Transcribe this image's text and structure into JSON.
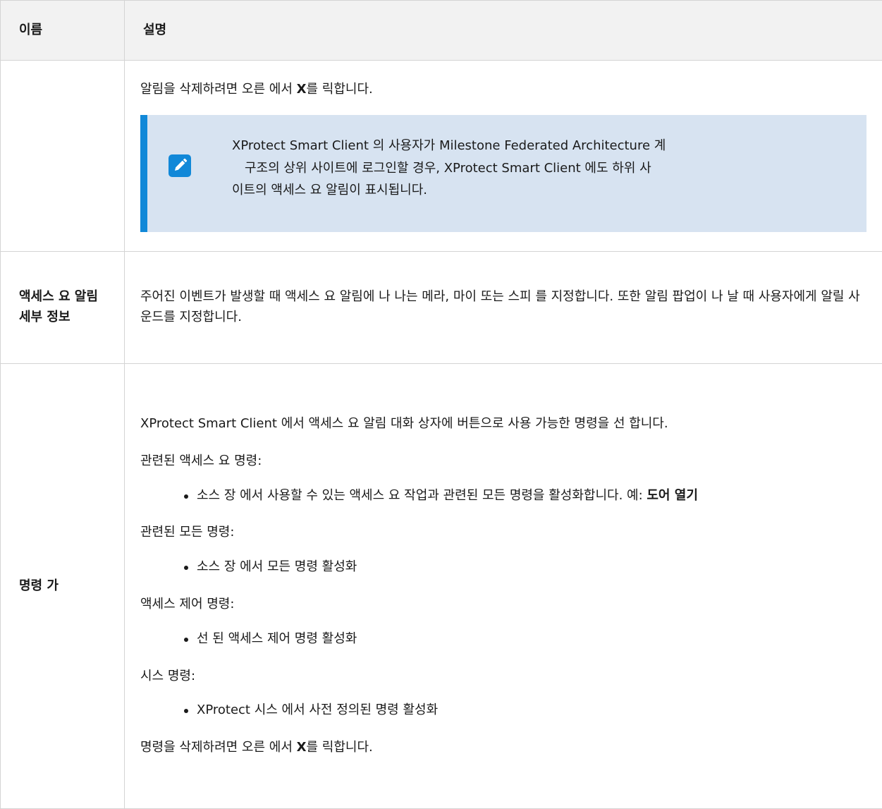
{
  "header": {
    "col_name": "이름",
    "col_desc": "설명"
  },
  "rows": [
    {
      "name": "",
      "desc_text": "알림을 삭제하려면 오른   에서 ",
      "desc_bold": "X",
      "desc_after": "를    릭합니다.",
      "note": {
        "icon": "pencil-icon",
        "line1": "XProtect Smart Client 의 사용자가 Milestone Federated Architecture 계",
        "line2": "구조의 상위 사이트에 로그인할 경우, XProtect Smart Client 에도 하위 사",
        "line3": "이트의 액세스 요    알림이 표시됩니다."
      }
    },
    {
      "name": "액세스 요 알림 세부 정보",
      "desc": "주어진 이벤트가 발생할 때 액세스 요    알림에 나    나는    메라, 마이    또는 스피    를 지정합니다. 또한 알림 팝업이 나    날 때 사용자에게 알릴 사운드를 지정합니다."
    },
    {
      "name": "명령    가",
      "intro": "XProtect Smart Client 에서 액세스 요    알림 대화 상자에 버튼으로 사용 가능한 명령을 선    합니다.",
      "group1_label": "관련된 액세스 요    명령:",
      "group1_bullet": "소스 장    에서 사용할 수 있는 액세스 요    작업과 관련된 모든 명령을 활성화합니다. 예: ",
      "group1_bullet_bold": "도어 열기",
      "group2_label": "관련된 모든 명령:",
      "group2_bullet": "소스 장    에서 모든 명령 활성화",
      "group3_label": "액세스 제어 명령:",
      "group3_bullet": "선    된 액세스 제어 명령 활성화",
      "group4_label": "시스    명령:",
      "group4_bullet": "XProtect 시스    에서 사전 정의된 명령 활성화",
      "outro_text": "명령을 삭제하려면 오른   에서 ",
      "outro_bold": "X",
      "outro_after": "를    릭합니다."
    }
  ],
  "colors": {
    "header_bg": "#f2f2f2",
    "note_bg": "#d7e3f1",
    "note_accent": "#1188d8",
    "border": "#d4d4d4"
  }
}
